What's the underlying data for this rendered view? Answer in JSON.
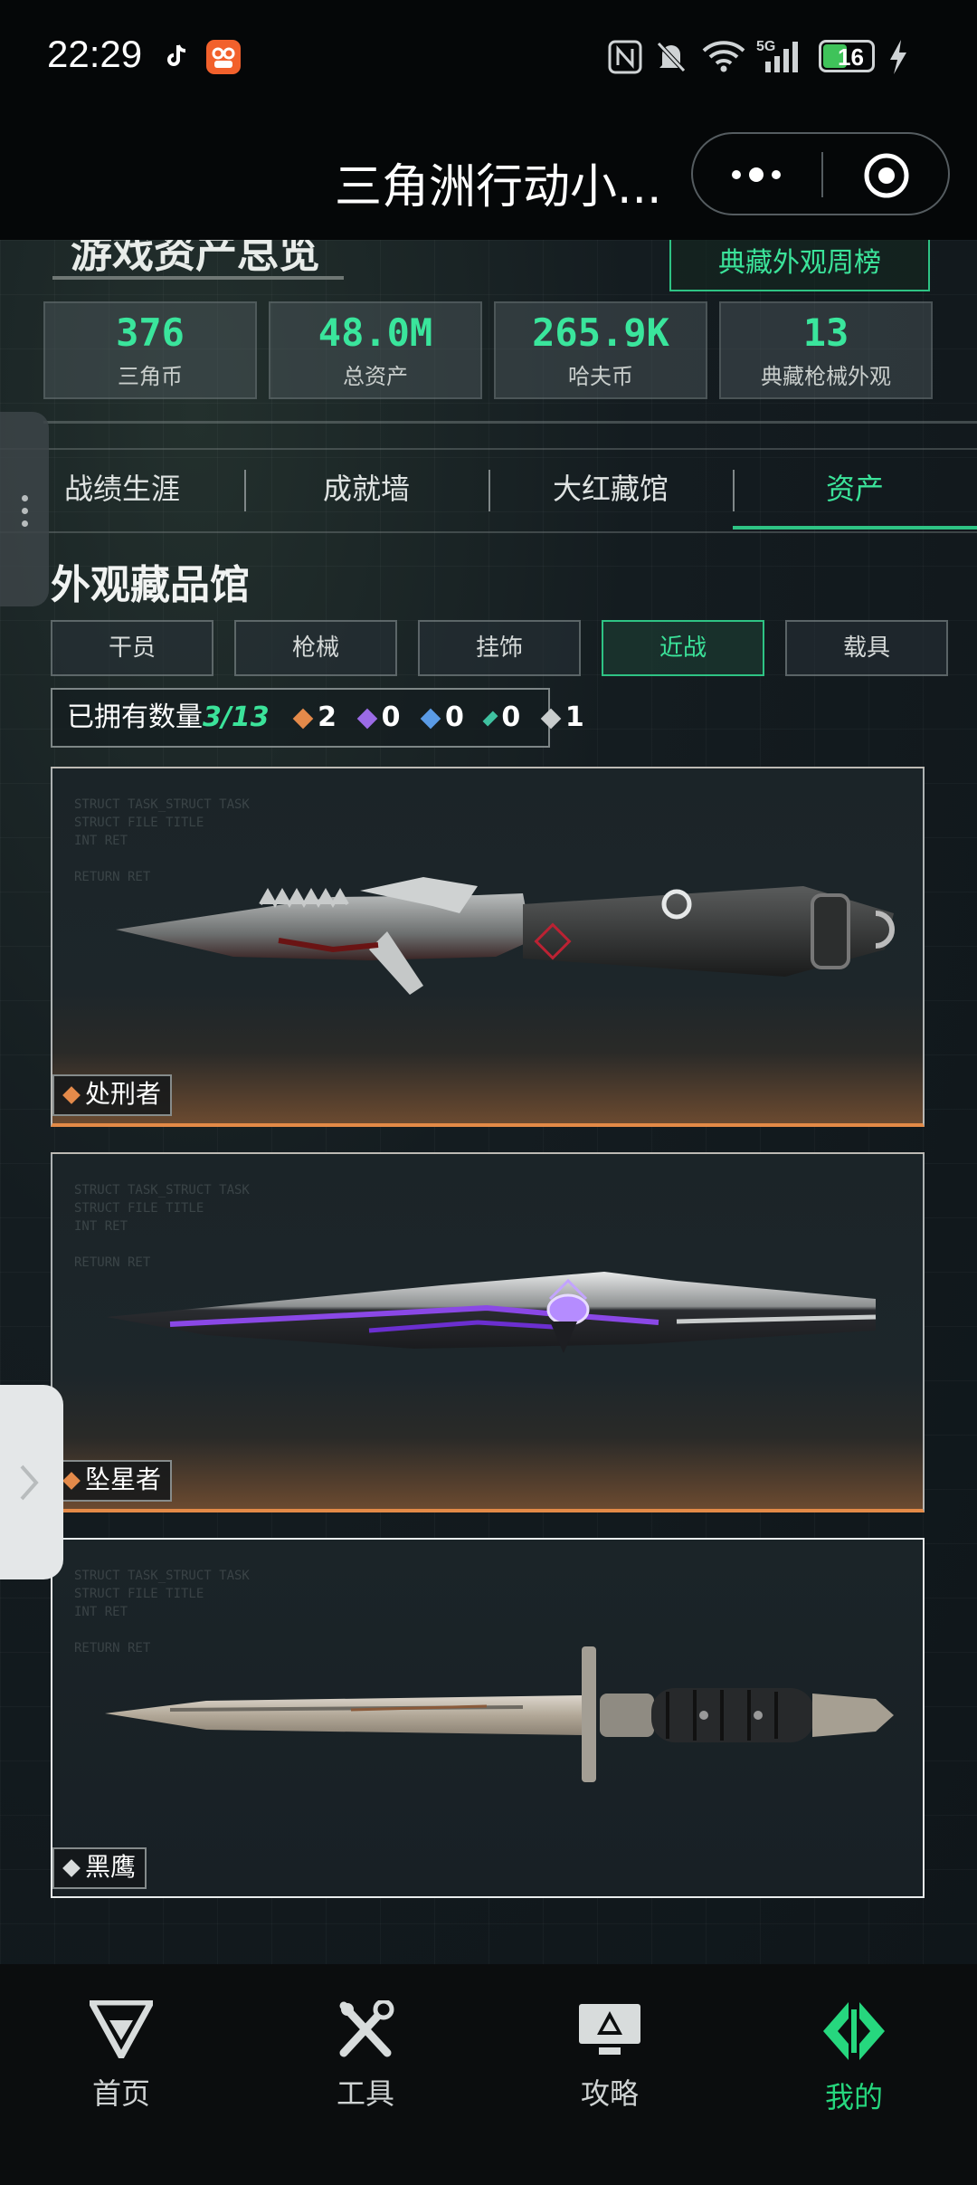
{
  "status_bar": {
    "time": "22:29",
    "battery": "16",
    "icons": [
      "tiktok-icon",
      "app-icon",
      "nfc-icon",
      "mute-icon",
      "wifi-icon",
      "5g-signal-icon",
      "battery-icon",
      "charging-icon"
    ]
  },
  "mini_program": {
    "title": "三角洲行动小...",
    "more_icon": "more-dots-icon",
    "close_icon": "target-close-icon"
  },
  "assets": {
    "title": "游戏资产总览",
    "weekly_rank_button": "典藏外观周榜",
    "stats": [
      {
        "value": "376",
        "label": "三角币"
      },
      {
        "value": "48.0M",
        "label": "总资产"
      },
      {
        "value": "265.9K",
        "label": "哈夫币"
      },
      {
        "value": "13",
        "label": "典藏枪械外观"
      }
    ]
  },
  "tabs": [
    {
      "label": "战绩生涯",
      "active": false
    },
    {
      "label": "成就墙",
      "active": false
    },
    {
      "label": "大红藏馆",
      "active": false
    },
    {
      "label": "资产",
      "active": true
    }
  ],
  "collection": {
    "title": "外观藏品馆",
    "categories": [
      {
        "label": "干员",
        "active": false
      },
      {
        "label": "枪械",
        "active": false
      },
      {
        "label": "挂饰",
        "active": false
      },
      {
        "label": "近战",
        "active": true
      },
      {
        "label": "载具",
        "active": false
      }
    ],
    "owned_label": "已拥有数量",
    "owned_count": "3/13",
    "rarity_counts": [
      {
        "count": "2",
        "color": "#e48a4a"
      },
      {
        "count": "0",
        "color": "#9b6be6"
      },
      {
        "count": "0",
        "color": "#5a9be6"
      },
      {
        "count": "0",
        "color": "#3fc1a0"
      },
      {
        "count": "1",
        "color": "#c9cdcd"
      }
    ],
    "items": [
      {
        "name": "处刑者",
        "rarity_color": "#e48a4a"
      },
      {
        "name": "坠星者",
        "rarity_color": "#e48a4a"
      },
      {
        "name": "黑鹰",
        "rarity_color": "#d8dcdc"
      }
    ]
  },
  "bottom_nav": [
    {
      "label": "首页",
      "icon": "home-logo-icon",
      "active": false
    },
    {
      "label": "工具",
      "icon": "tools-icon",
      "active": false
    },
    {
      "label": "攻略",
      "icon": "guide-monitor-icon",
      "active": false
    },
    {
      "label": "我的",
      "icon": "profile-logo-icon",
      "active": true
    }
  ],
  "colors": {
    "accent": "#2ec384",
    "accent_text": "#3be39a",
    "background": "#0e1418"
  }
}
